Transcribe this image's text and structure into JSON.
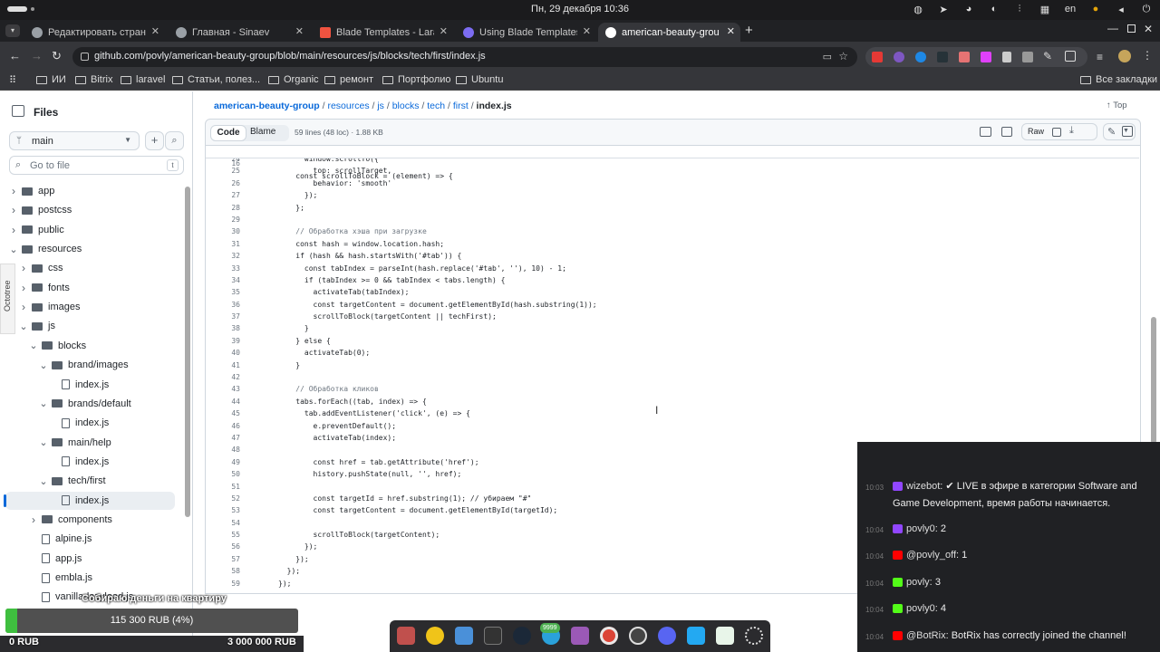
{
  "system": {
    "clock": "Пн, 29 декабря 10:36",
    "lang": "en"
  },
  "browser": {
    "tabs": [
      {
        "title": "Редактировать страниц",
        "favicon_color": "#9aa0a6"
      },
      {
        "title": "Главная - Sinaev",
        "favicon_color": "#9aa0a6"
      },
      {
        "title": "Blade Templates - Larave",
        "favicon_color": "#f05340"
      },
      {
        "title": "Using Blade Templates in",
        "favicon_color": "#7c6cf2"
      },
      {
        "title": "american-beauty-group/",
        "favicon_color": "#ffffff"
      }
    ],
    "url": "github.com/povly/american-beauty-group/blob/main/resources/js/blocks/tech/first/index.js",
    "bookmarks": [
      "ИИ",
      "Bitrix",
      "laravel",
      "Статьи, полез...",
      "Organic",
      "ремонт",
      "Портфолио",
      "Ubuntu"
    ],
    "bookmarks_all": "Все закладки"
  },
  "sidebar": {
    "title": "Files",
    "branch": "main",
    "search_placeholder": "Go to file",
    "search_shortcut": "t",
    "tree": [
      {
        "label": "app",
        "type": "dir",
        "depth": 0,
        "open": false
      },
      {
        "label": "postcss",
        "type": "dir",
        "depth": 0,
        "open": false
      },
      {
        "label": "public",
        "type": "dir",
        "depth": 0,
        "open": false
      },
      {
        "label": "resources",
        "type": "dir",
        "depth": 0,
        "open": true
      },
      {
        "label": "css",
        "type": "dir",
        "depth": 1,
        "open": false
      },
      {
        "label": "fonts",
        "type": "dir",
        "depth": 1,
        "open": false
      },
      {
        "label": "images",
        "type": "dir",
        "depth": 1,
        "open": false
      },
      {
        "label": "js",
        "type": "dir",
        "depth": 1,
        "open": true
      },
      {
        "label": "blocks",
        "type": "dir",
        "depth": 2,
        "open": true
      },
      {
        "label": "brand/images",
        "type": "dir",
        "depth": 3,
        "open": true
      },
      {
        "label": "index.js",
        "type": "file",
        "depth": 4
      },
      {
        "label": "brands/default",
        "type": "dir",
        "depth": 3,
        "open": true
      },
      {
        "label": "index.js",
        "type": "file",
        "depth": 4
      },
      {
        "label": "main/help",
        "type": "dir",
        "depth": 3,
        "open": true
      },
      {
        "label": "index.js",
        "type": "file",
        "depth": 4
      },
      {
        "label": "tech/first",
        "type": "dir",
        "depth": 3,
        "open": true
      },
      {
        "label": "index.js",
        "type": "file",
        "depth": 4,
        "selected": true
      },
      {
        "label": "components",
        "type": "dir",
        "depth": 2,
        "open": false
      },
      {
        "label": "alpine.js",
        "type": "file",
        "depth": 2
      },
      {
        "label": "app.js",
        "type": "file",
        "depth": 2
      },
      {
        "label": "embla.js",
        "type": "file",
        "depth": 2
      },
      {
        "label": "vanilla-lazyload.js",
        "type": "file",
        "depth": 2
      }
    ],
    "octotree": "Octotree"
  },
  "file": {
    "breadcrumb": [
      "american-beauty-group",
      "resources",
      "js",
      "blocks",
      "tech",
      "first"
    ],
    "filename": "index.js",
    "top_label": "Top",
    "tab_code": "Code",
    "tab_blame": "Blame",
    "meta": "59 lines (48 loc) · 1.88 KB",
    "raw_label": "Raw",
    "sticky_line": {
      "n": "16",
      "text": "    const scrollToBlock = (element) => {"
    },
    "lines": [
      {
        "n": "24",
        "text": "      window.scrollTo({"
      },
      {
        "n": "25",
        "text": "        top: scrollTarget,"
      },
      {
        "n": "26",
        "text": "        behavior: 'smooth'"
      },
      {
        "n": "27",
        "text": "      });"
      },
      {
        "n": "28",
        "text": "    };"
      },
      {
        "n": "29",
        "text": ""
      },
      {
        "n": "30",
        "text": "    // Обработка хэша при загрузке"
      },
      {
        "n": "31",
        "text": "    const hash = window.location.hash;"
      },
      {
        "n": "32",
        "text": "    if (hash && hash.startsWith('#tab')) {"
      },
      {
        "n": "33",
        "text": "      const tabIndex = parseInt(hash.replace('#tab', ''), 10) - 1;"
      },
      {
        "n": "34",
        "text": "      if (tabIndex >= 0 && tabIndex < tabs.length) {"
      },
      {
        "n": "35",
        "text": "        activateTab(tabIndex);"
      },
      {
        "n": "36",
        "text": "        const targetContent = document.getElementById(hash.substring(1));"
      },
      {
        "n": "37",
        "text": "        scrollToBlock(targetContent || techFirst);"
      },
      {
        "n": "38",
        "text": "      }"
      },
      {
        "n": "39",
        "text": "    } else {"
      },
      {
        "n": "40",
        "text": "      activateTab(0);"
      },
      {
        "n": "41",
        "text": "    }"
      },
      {
        "n": "42",
        "text": ""
      },
      {
        "n": "43",
        "text": "    // Обработка кликов"
      },
      {
        "n": "44",
        "text": "    tabs.forEach((tab, index) => {"
      },
      {
        "n": "45",
        "text": "      tab.addEventListener('click', (e) => {"
      },
      {
        "n": "46",
        "text": "        e.preventDefault();"
      },
      {
        "n": "47",
        "text": "        activateTab(index);"
      },
      {
        "n": "48",
        "text": ""
      },
      {
        "n": "49",
        "text": "        const href = tab.getAttribute('href');"
      },
      {
        "n": "50",
        "text": "        history.pushState(null, '', href);"
      },
      {
        "n": "51",
        "text": ""
      },
      {
        "n": "52",
        "text": "        const targetId = href.substring(1); // убираем \"#\""
      },
      {
        "n": "53",
        "text": "        const targetContent = document.getElementById(targetId);"
      },
      {
        "n": "54",
        "text": ""
      },
      {
        "n": "55",
        "text": "        scrollToBlock(targetContent);"
      },
      {
        "n": "56",
        "text": "      });"
      },
      {
        "n": "57",
        "text": "    });"
      },
      {
        "n": "58",
        "text": "  });"
      },
      {
        "n": "59",
        "text": "});"
      }
    ]
  },
  "chat": [
    {
      "time": "10:03",
      "user": "wizebot:",
      "text": "✔ LIVE в эфире в категории Software and Game Development, время работы начинается.",
      "badge_color": "#9146ff"
    },
    {
      "time": "10:04",
      "user": "povly0:",
      "text": "2",
      "badge_color": "#9146ff"
    },
    {
      "time": "10:04",
      "user": "@povly_off:",
      "text": "1",
      "badge_color": "#ff0000"
    },
    {
      "time": "10:04",
      "user": "povly:",
      "text": "3",
      "badge_color": "#53fc18"
    },
    {
      "time": "10:04",
      "user": "povly0:",
      "text": "4",
      "badge_color": "#53fc18"
    },
    {
      "time": "10:04",
      "user": "@BotRix:",
      "text": "BotRix has correctly joined the channel!",
      "badge_color": "#ff0000"
    }
  ],
  "donation": {
    "title": "Собираю деньги на квартиру",
    "progress_label": "115 300 RUB (4%)",
    "progress": 0.04,
    "min_label": "0 RUB",
    "max_label": "3 000 000 RUB"
  },
  "dock": {
    "badge": "9999"
  }
}
